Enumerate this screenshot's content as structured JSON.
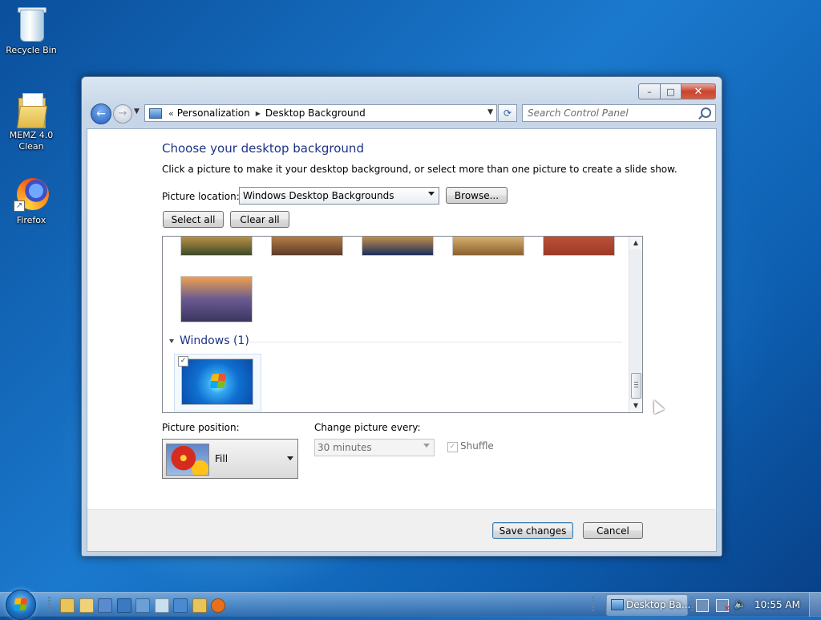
{
  "desktop": {
    "icons": [
      {
        "label": "Recycle Bin"
      },
      {
        "label": "MEMZ 4.0 Clean"
      },
      {
        "label": "Firefox"
      }
    ]
  },
  "window": {
    "controls": {
      "minimize": "–",
      "maximize": "□",
      "close": "✕"
    },
    "nav": {
      "back_glyph": "←",
      "forward_glyph": "→",
      "breadcrumb_overflow": "«",
      "breadcrumb": [
        "Personalization",
        "Desktop Background"
      ],
      "refresh_glyph": "⟳",
      "search_placeholder": "Search Control Panel"
    },
    "heading": "Choose your desktop background",
    "subtext": "Click a picture to make it your desktop background, or select more than one picture to create a slide show.",
    "picture_location": {
      "label": "Picture location:",
      "value": "Windows Desktop Backgrounds",
      "browse_label": "Browse..."
    },
    "select_all_label": "Select all",
    "clear_all_label": "Clear all",
    "gallery": {
      "thumbnails": [
        {
          "name": "landscape-1",
          "colors": [
            "#7a5a2a",
            "#d6a04a",
            "#3d4a2a"
          ]
        },
        {
          "name": "landscape-2",
          "colors": [
            "#30466e",
            "#c98c4a",
            "#5c3b2a"
          ]
        },
        {
          "name": "landscape-3",
          "colors": [
            "#2a4b8a",
            "#e8a24a",
            "#1a2f5a"
          ]
        },
        {
          "name": "landscape-4",
          "colors": [
            "#caa060",
            "#e7c07a",
            "#8a6030"
          ]
        },
        {
          "name": "landscape-5",
          "colors": [
            "#3a68b8",
            "#c6553a",
            "#9a3a28"
          ]
        },
        {
          "name": "landscape-6",
          "colors": [
            "#f0a050",
            "#6a5a90",
            "#3a3560"
          ]
        }
      ],
      "group_title": "Windows (1)",
      "windows_item_checked": "✓"
    },
    "picture_position": {
      "label": "Picture position:",
      "value": "Fill"
    },
    "change_picture": {
      "label": "Change picture every:",
      "value": "30 minutes"
    },
    "shuffle": {
      "label": "Shuffle",
      "checked_glyph": "✓"
    },
    "save_label": "Save changes",
    "cancel_label": "Cancel"
  },
  "taskbar": {
    "active_task": "Desktop Ba...",
    "clock": "10:55 AM",
    "quick_launch": [
      {
        "name": "explorer-icon",
        "color": "#e8c45a"
      },
      {
        "name": "documents-icon",
        "color": "#f0d27a"
      },
      {
        "name": "computer-icon",
        "color": "#5a8ad0"
      },
      {
        "name": "network-icon",
        "color": "#3a7ac0"
      },
      {
        "name": "control-panel-icon",
        "color": "#6aa0d8"
      },
      {
        "name": "recycle-bin-icon",
        "color": "#c8dff0"
      },
      {
        "name": "display-icon",
        "color": "#4a8ad0"
      },
      {
        "name": "folder-icon",
        "color": "#e8c45a"
      },
      {
        "name": "firefox-icon",
        "color": "#e8701c"
      }
    ]
  }
}
